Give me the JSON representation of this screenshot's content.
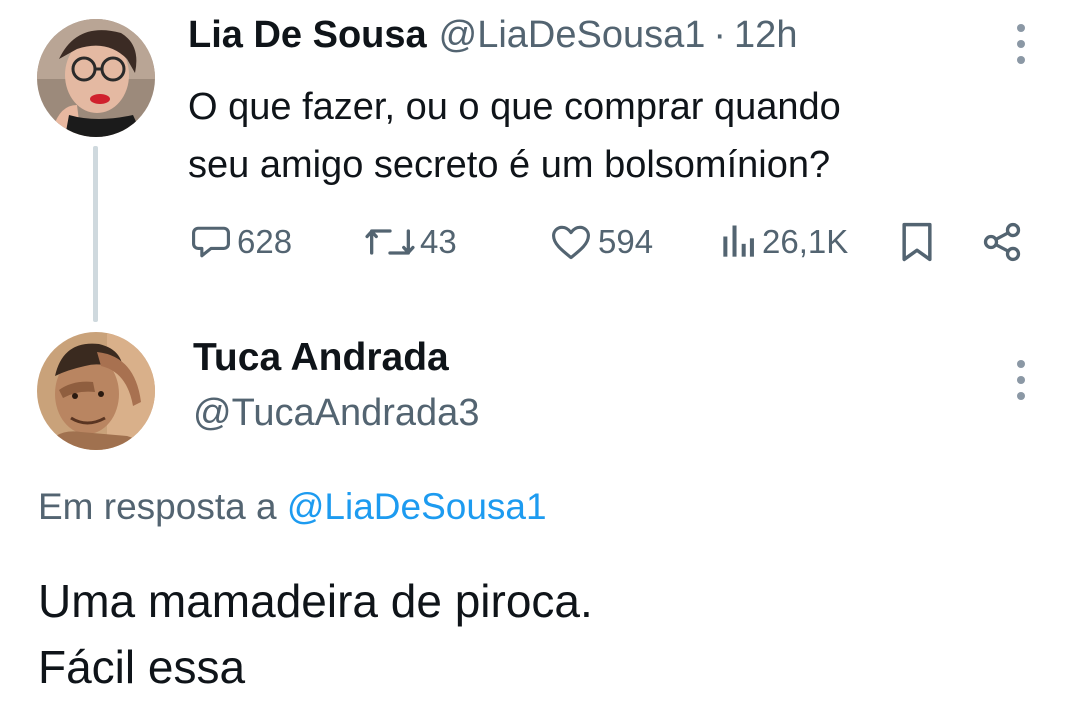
{
  "parent_tweet": {
    "author_name": "Lia De Sousa",
    "handle": "@LiaDeSousa1",
    "separator": "·",
    "time": "12h",
    "text": "O que fazer, ou o que comprar quando\nseu amigo secreto é um bolsomínion?",
    "stats": {
      "replies": "628",
      "retweets": "43",
      "likes": "594",
      "views": "26,1K"
    }
  },
  "reply_tweet": {
    "author_name": "Tuca Andrada",
    "handle": "@TucaAndrada3",
    "reply_prefix": "Em resposta a",
    "reply_to_handle": "@LiaDeSousa1",
    "text": "Uma mamadeira de piroca.\nFácil essa"
  },
  "icons": {
    "reply": "speech-bubble-icon",
    "retweet": "retweet-arrows-icon",
    "like": "heart-icon",
    "views": "bar-chart-icon",
    "bookmark": "bookmark-icon",
    "share": "share-nodes-icon",
    "more": "vertical-dots-icon"
  },
  "colors": {
    "text_primary": "#0f1419",
    "text_secondary": "#536471",
    "link": "#1d9bf0",
    "thread_line": "#cfd9de"
  }
}
